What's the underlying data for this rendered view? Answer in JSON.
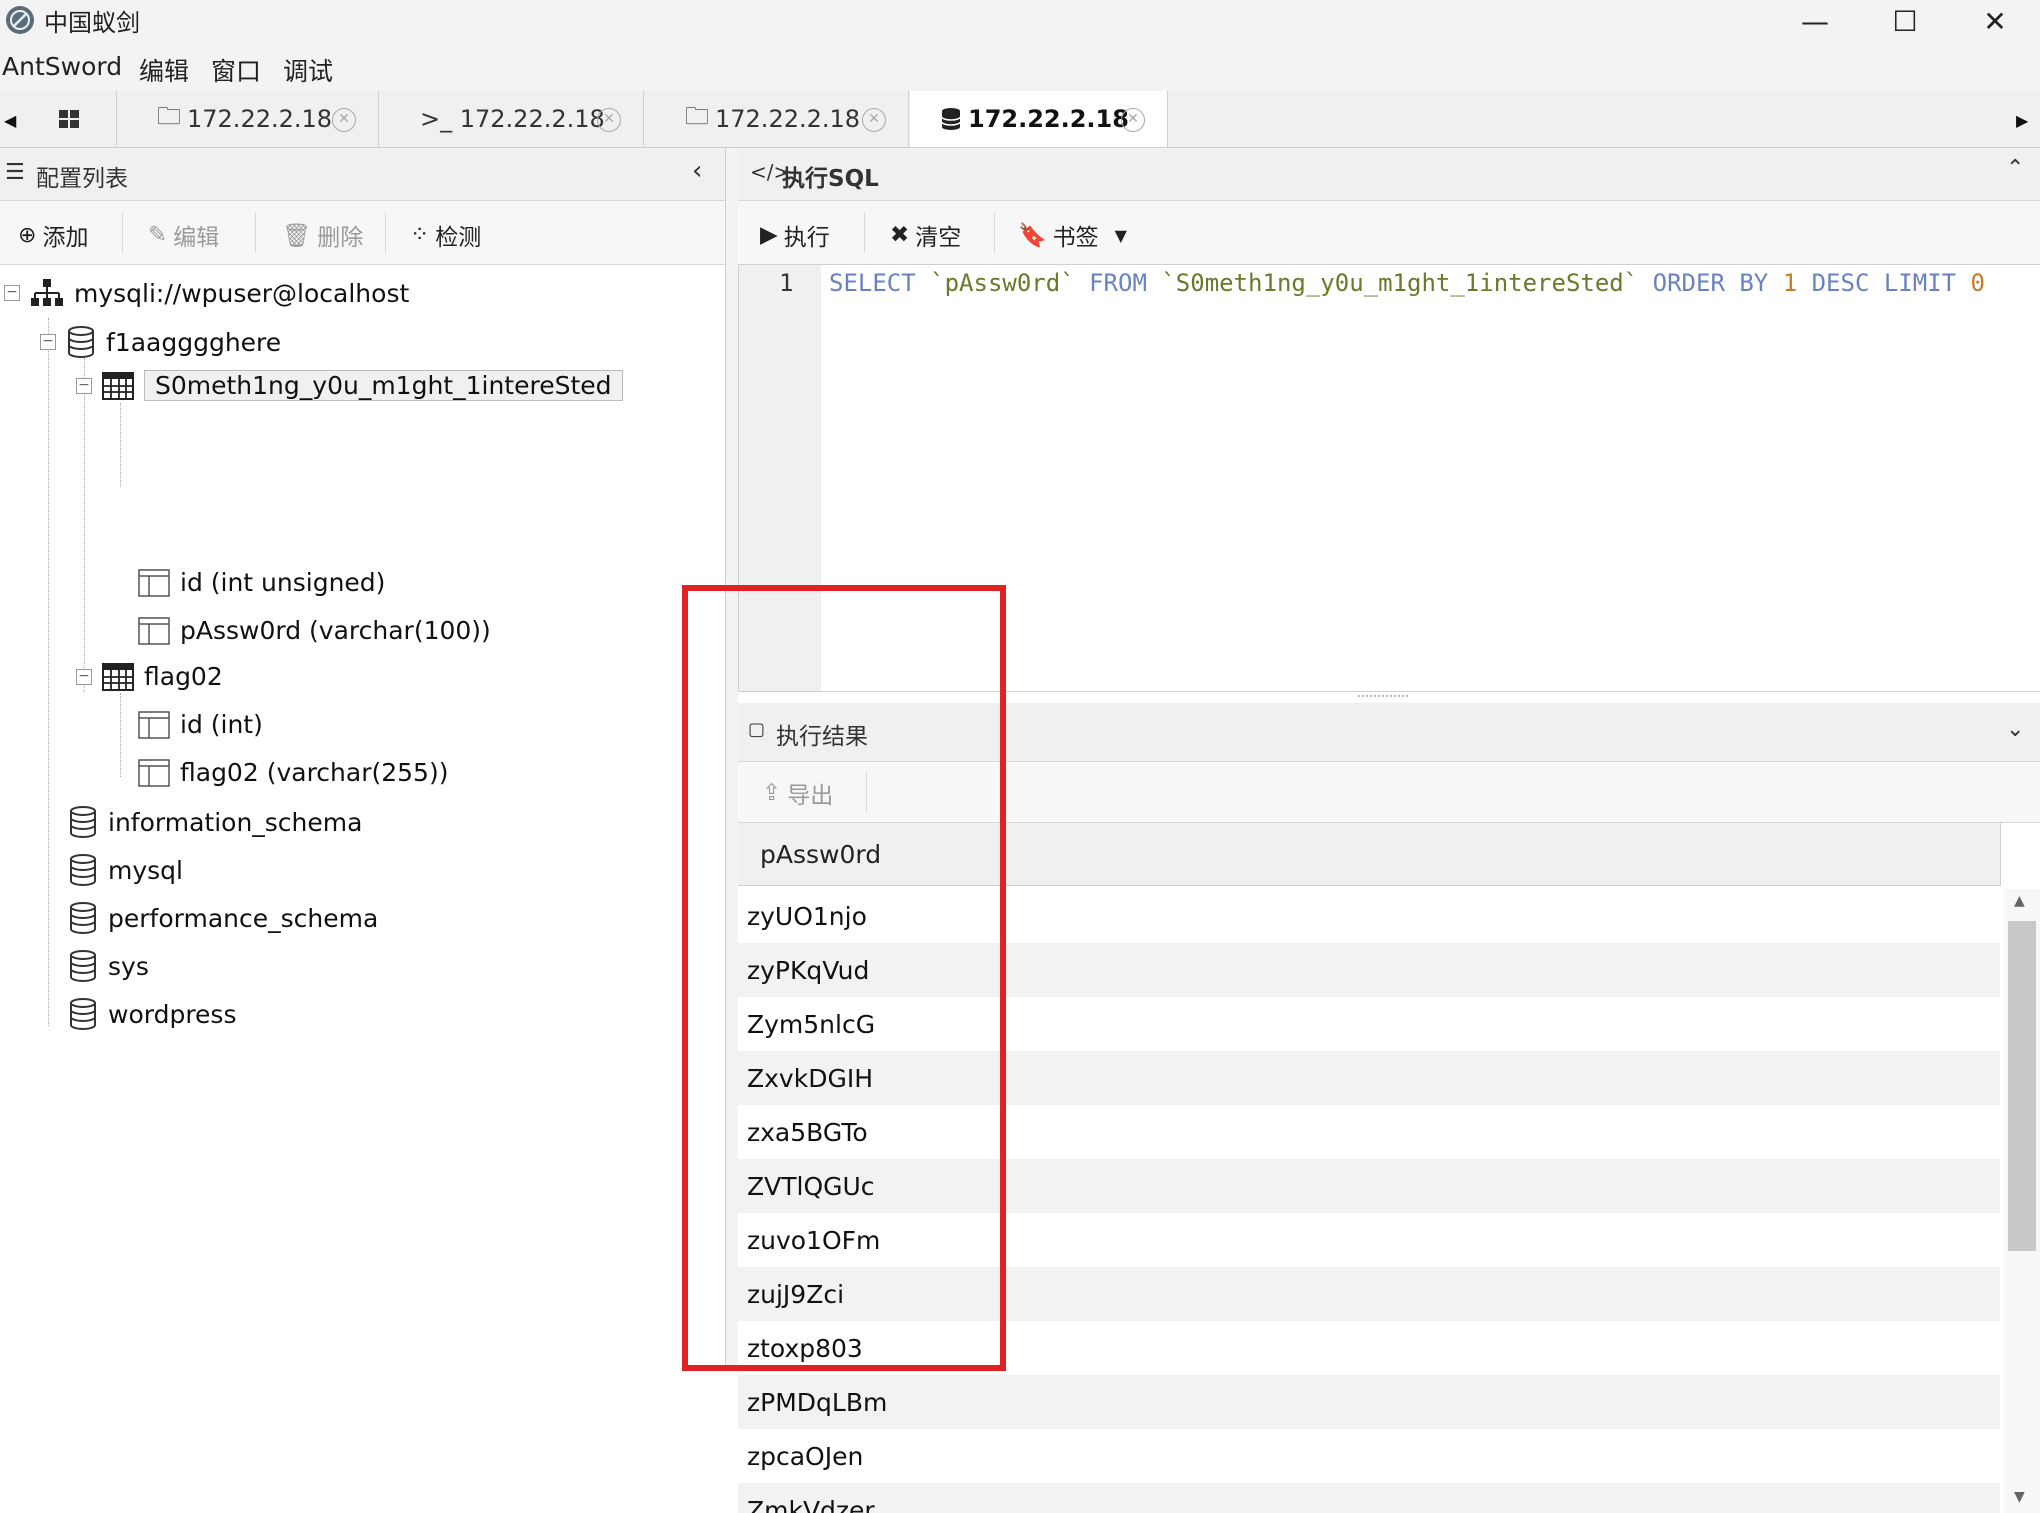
{
  "window": {
    "title": "中国蚁剑",
    "controls": {
      "minimize": "—",
      "maximize": "☐",
      "close": "✕"
    }
  },
  "menu": [
    "AntSword",
    "编辑",
    "窗口",
    "调试"
  ],
  "tabs": [
    {
      "icon": "grid-icon",
      "label": ""
    },
    {
      "icon": "folder-icon",
      "label": "172.22.2.18"
    },
    {
      "icon": "terminal-icon",
      "label": ">_ 172.22.2.18"
    },
    {
      "icon": "folder-icon",
      "label": "172.22.2.18"
    },
    {
      "icon": "database-icon",
      "label": "172.22.2.18",
      "active": true
    }
  ],
  "left": {
    "header": "配置列表",
    "toolbar": {
      "add": "添加",
      "edit": "编辑",
      "delete": "删除",
      "check": "检测"
    },
    "tree": {
      "connection": "mysqli://wpuser@localhost",
      "db1": "f1aagggghere",
      "table1": "S0meth1ng_y0u_m1ght_1intereSted",
      "t1_col1": "id (int unsigned)",
      "t1_col2": "pAssw0rd (varchar(100))",
      "table2": "flag02",
      "t2_col1": "id (int)",
      "t2_col2": "flag02 (varchar(255))",
      "db2": "information_schema",
      "db3": "mysql",
      "db4": "performance_schema",
      "db5": "sys",
      "db6": "wordpress"
    }
  },
  "right": {
    "sql_header": "执行SQL",
    "sql_header_prefix": "</>",
    "toolbar": {
      "exec": "执行",
      "clear": "清空",
      "bookmark": "书签"
    },
    "editor": {
      "line_no": "1",
      "tokens": {
        "kw1": "SELECT",
        "field": "`pAssw0rd`",
        "kw2": "FROM",
        "table": "`S0meth1ng_y0u_m1ght_1intereSted`",
        "kw3": "ORDER BY",
        "num": "1",
        "kw4": "DESC LIMIT",
        "num2": "0"
      }
    },
    "result_header": "执行结果",
    "export": "导出",
    "column": "pAssw0rd",
    "rows": [
      "zyUO1njo",
      "zyPKqVud",
      "Zym5nlcG",
      "ZxvkDGIH",
      "zxa5BGTo",
      "ZVTlQGUc",
      "zuvo1OFm",
      "zujJ9Zci",
      "ztoxp803",
      "zPMDqLBm",
      "zpcaOJen",
      "ZmkVdzer"
    ]
  },
  "colors": {
    "highlight_box": "#e02222",
    "keyword": "#b58900",
    "string": "#6a7a2a"
  }
}
